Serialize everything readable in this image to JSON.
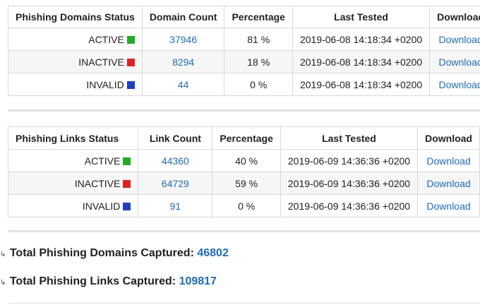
{
  "domains": {
    "headers": [
      "Phishing Domains Status",
      "Domain Count",
      "Percentage",
      "Last Tested",
      "Download"
    ],
    "rows": [
      {
        "status": "ACTIVE",
        "color": "#22aa22",
        "count": "37946",
        "pct": "81 %",
        "tested": "2019-06-08 14:18:34 +0200",
        "dl": "Download"
      },
      {
        "status": "INACTIVE",
        "color": "#dd2222",
        "count": "8294",
        "pct": "18 %",
        "tested": "2019-06-08 14:18:34 +0200",
        "dl": "Download"
      },
      {
        "status": "INVALID",
        "color": "#1f3fbf",
        "count": "44",
        "pct": "0 %",
        "tested": "2019-06-08 14:18:34 +0200",
        "dl": "Download"
      }
    ]
  },
  "links": {
    "headers": [
      "Phishing Links Status",
      "Link Count",
      "Percentage",
      "Last Tested",
      "Download"
    ],
    "rows": [
      {
        "status": "ACTIVE",
        "color": "#22aa22",
        "count": "44360",
        "pct": "40 %",
        "tested": "2019-06-09 14:36:36 +0200",
        "dl": "Download"
      },
      {
        "status": "INACTIVE",
        "color": "#dd2222",
        "count": "64729",
        "pct": "59 %",
        "tested": "2019-06-09 14:36:36 +0200",
        "dl": "Download"
      },
      {
        "status": "INVALID",
        "color": "#1f3fbf",
        "count": "91",
        "pct": "0 %",
        "tested": "2019-06-09 14:36:36 +0200",
        "dl": "Download"
      }
    ]
  },
  "totals": {
    "domains_label": "Total Phishing Domains Captured:",
    "domains_value": "46802",
    "links_label": "Total Phishing Links Captured:",
    "links_value": "109817"
  }
}
